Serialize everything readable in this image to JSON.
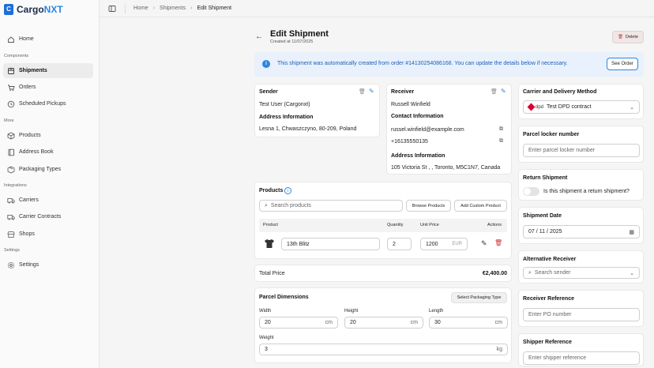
{
  "app": {
    "logo_prefix": "Cargo",
    "logo_suffix": "NXT",
    "logo_mark": "C"
  },
  "sidebar": {
    "home": "Home",
    "section_shipments": "Components",
    "shipments": "Shipments",
    "orders": "Orders",
    "scheduled": "Scheduled Pickups",
    "section_more": "More",
    "products": "Products",
    "address_book": "Address Book",
    "packaging": "Packaging Types",
    "section_integrations": "Integrations",
    "carriers": "Carriers",
    "contracts": "Carrier Contracts",
    "shops": "Shops",
    "section_settings": "Settings",
    "settings": "Settings"
  },
  "breadcrumb": {
    "home": "Home",
    "shipments": "Shipments",
    "current": "Edit Shipment"
  },
  "page": {
    "title": "Edit Shipment",
    "created": "Created at 11/07/2025",
    "delete": "Delete"
  },
  "banner": {
    "text": "This shipment was automatically created from order #14130254086168. You can update the details below if necessary.",
    "button": "See Order"
  },
  "sender": {
    "title": "Sender",
    "name": "Test User (Cargonxt)",
    "address_title": "Address Information",
    "address": "Lesna 1, Chwaszczyno, 80-209, Poland"
  },
  "receiver": {
    "title": "Receiver",
    "name": "Russell Winfield",
    "contact_title": "Contact Information",
    "email": "russel.winfield@example.com",
    "phone": "+16135550135",
    "address_title": "Address Information",
    "address": "105 Victoria St , , Toronto, M5C1N7, Canada"
  },
  "products": {
    "title": "Products",
    "search_placeholder": "Search products",
    "browse": "Browse Products",
    "add_custom": "Add Custom Product",
    "col_product": "Product",
    "col_quantity": "Quantity",
    "col_unit_price": "Unit Price",
    "col_actions": "Actions",
    "rows": [
      {
        "name": "13th Blitz",
        "quantity": "2",
        "price": "1200",
        "currency": "EUR"
      }
    ]
  },
  "total": {
    "label": "Total Price",
    "value": "€2,400.00"
  },
  "dimensions": {
    "title": "Parcel Dimensions",
    "select_packaging": "Select Packaging Type",
    "width_label": "Width",
    "width": "20",
    "height_label": "Height",
    "height": "20",
    "length_label": "Length",
    "length": "30",
    "weight_label": "Weight",
    "weight": "3",
    "unit_cm": "cm",
    "unit_kg": "kg"
  },
  "carrier": {
    "title": "Carrier and Delivery Method",
    "dpd_logo": "dpd",
    "selected": "Test DPD contract"
  },
  "locker": {
    "title": "Parcel locker number",
    "placeholder": "Enter parcel locker number"
  },
  "return": {
    "title": "Return Shipment",
    "question": "Is this shipment a return shipment?",
    "enabled": false
  },
  "date": {
    "title": "Shipment Date",
    "month": "07",
    "day": "11",
    "year": "2025",
    "sep": "/"
  },
  "alt_receiver": {
    "title": "Alternative Receiver",
    "placeholder": "Search sender"
  },
  "receiver_ref": {
    "title": "Receiver Reference",
    "placeholder": "Enter PO number"
  },
  "shipper_ref": {
    "title": "Shipper Reference",
    "placeholder": "Enter shipper reference"
  },
  "colors": {
    "accent": "#2b86e0",
    "banner_bg": "#e8f1fc",
    "delete_bg": "#f0e6e6"
  }
}
